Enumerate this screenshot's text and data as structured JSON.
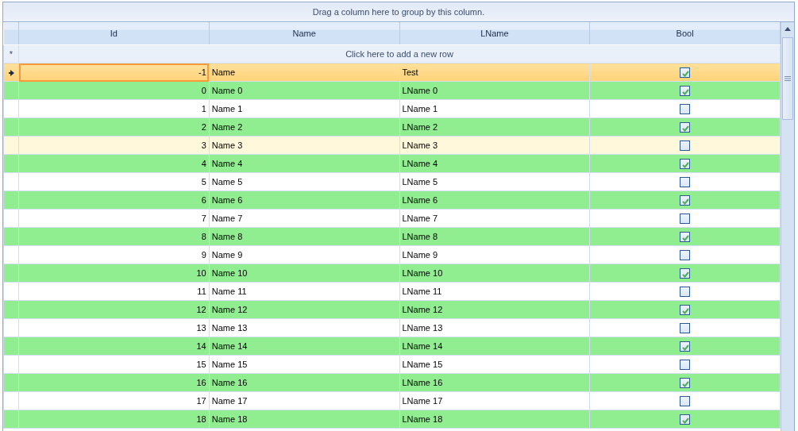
{
  "group_panel": {
    "text": "Drag a column here to group by this column."
  },
  "columns": [
    {
      "label": "Id",
      "kind": "number"
    },
    {
      "label": "Name",
      "kind": "text"
    },
    {
      "label": "LName",
      "kind": "text"
    },
    {
      "label": "Bool",
      "kind": "checkbox"
    }
  ],
  "new_row": {
    "indicator": "*",
    "text": "Click here to add a new row"
  },
  "rows": [
    {
      "current": true,
      "highlighted": false,
      "hovered": false,
      "id": "-1",
      "name": "Name",
      "lname": "Test",
      "checked": true
    },
    {
      "current": false,
      "highlighted": true,
      "hovered": false,
      "id": "0",
      "name": "Name 0",
      "lname": "LName 0",
      "checked": true
    },
    {
      "current": false,
      "highlighted": false,
      "hovered": false,
      "id": "1",
      "name": "Name 1",
      "lname": "LName 1",
      "checked": false
    },
    {
      "current": false,
      "highlighted": true,
      "hovered": false,
      "id": "2",
      "name": "Name 2",
      "lname": "LName 2",
      "checked": true
    },
    {
      "current": false,
      "highlighted": false,
      "hovered": true,
      "id": "3",
      "name": "Name 3",
      "lname": "LName 3",
      "checked": false
    },
    {
      "current": false,
      "highlighted": true,
      "hovered": false,
      "id": "4",
      "name": "Name 4",
      "lname": "LName 4",
      "checked": true
    },
    {
      "current": false,
      "highlighted": false,
      "hovered": false,
      "id": "5",
      "name": "Name 5",
      "lname": "LName 5",
      "checked": false
    },
    {
      "current": false,
      "highlighted": true,
      "hovered": false,
      "id": "6",
      "name": "Name 6",
      "lname": "LName 6",
      "checked": true
    },
    {
      "current": false,
      "highlighted": false,
      "hovered": false,
      "id": "7",
      "name": "Name 7",
      "lname": "LName 7",
      "checked": false
    },
    {
      "current": false,
      "highlighted": true,
      "hovered": false,
      "id": "8",
      "name": "Name 8",
      "lname": "LName 8",
      "checked": true
    },
    {
      "current": false,
      "highlighted": false,
      "hovered": false,
      "id": "9",
      "name": "Name 9",
      "lname": "LName 9",
      "checked": false
    },
    {
      "current": false,
      "highlighted": true,
      "hovered": false,
      "id": "10",
      "name": "Name 10",
      "lname": "LName 10",
      "checked": true
    },
    {
      "current": false,
      "highlighted": false,
      "hovered": false,
      "id": "11",
      "name": "Name 11",
      "lname": "LName 11",
      "checked": false
    },
    {
      "current": false,
      "highlighted": true,
      "hovered": false,
      "id": "12",
      "name": "Name 12",
      "lname": "LName 12",
      "checked": true
    },
    {
      "current": false,
      "highlighted": false,
      "hovered": false,
      "id": "13",
      "name": "Name 13",
      "lname": "LName 13",
      "checked": false
    },
    {
      "current": false,
      "highlighted": true,
      "hovered": false,
      "id": "14",
      "name": "Name 14",
      "lname": "LName 14",
      "checked": true
    },
    {
      "current": false,
      "highlighted": false,
      "hovered": false,
      "id": "15",
      "name": "Name 15",
      "lname": "LName 15",
      "checked": false
    },
    {
      "current": false,
      "highlighted": true,
      "hovered": false,
      "id": "16",
      "name": "Name 16",
      "lname": "LName 16",
      "checked": true
    },
    {
      "current": false,
      "highlighted": false,
      "hovered": false,
      "id": "17",
      "name": "Name 17",
      "lname": "LName 17",
      "checked": false
    },
    {
      "current": false,
      "highlighted": true,
      "hovered": false,
      "id": "18",
      "name": "Name 18",
      "lname": "LName 18",
      "checked": true
    }
  ]
}
